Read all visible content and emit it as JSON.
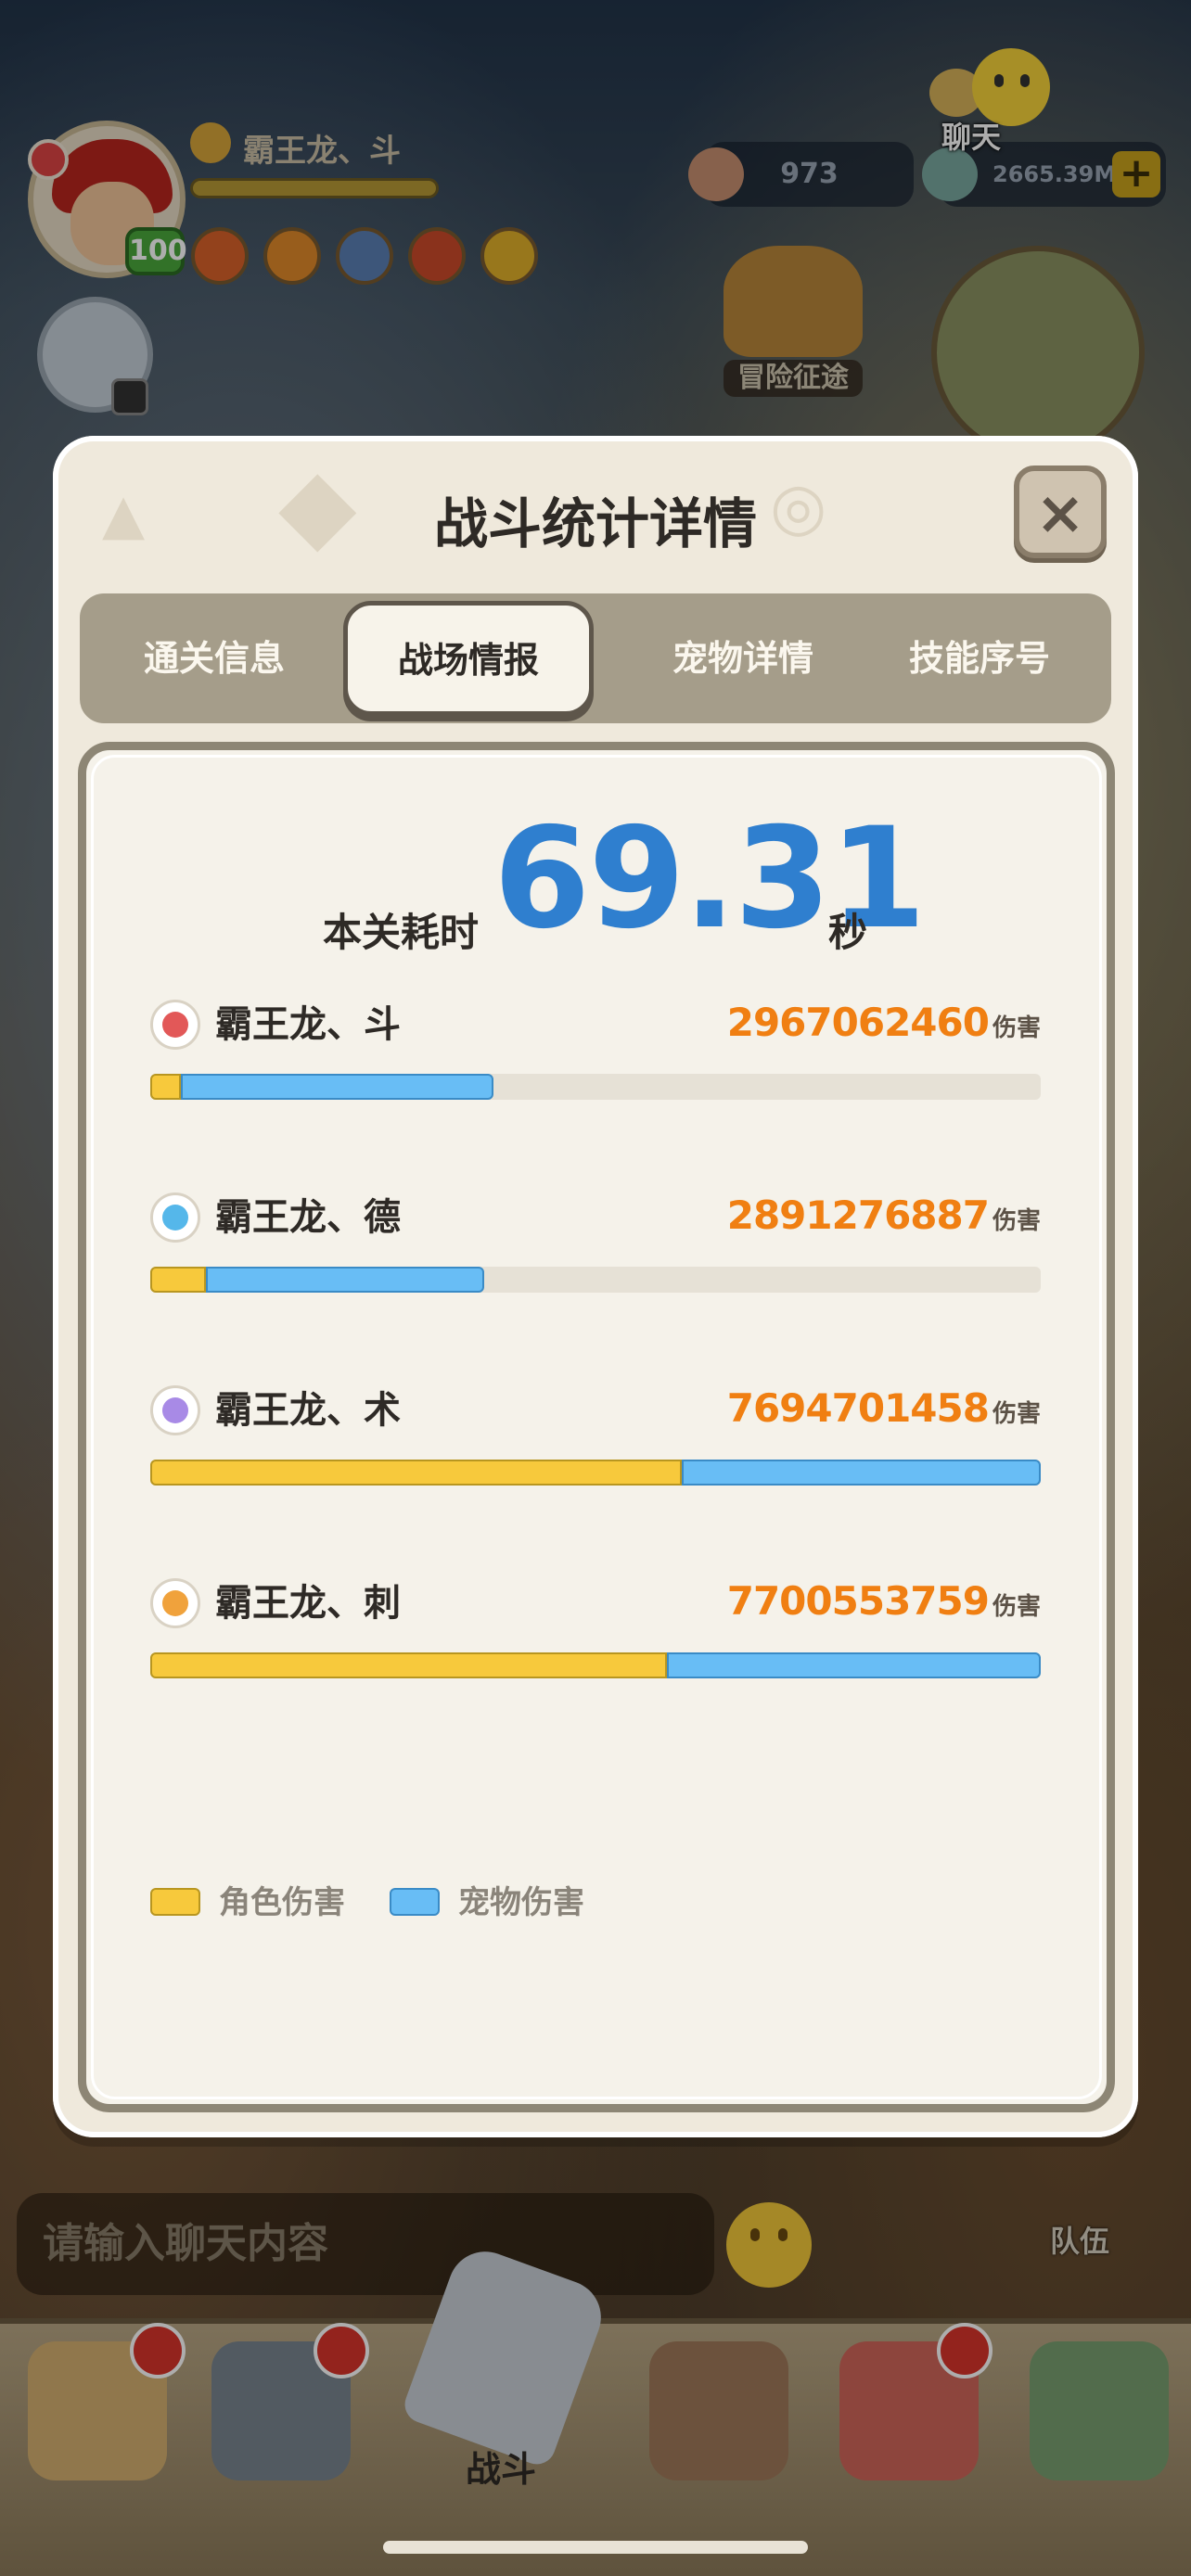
{
  "hud": {
    "player_name": "霸王龙、斗",
    "level": "100",
    "currency_1": "973",
    "currency_2": "2665.39M",
    "plus": "+",
    "chat_label": "聊天",
    "adventure_label": "冒险征途"
  },
  "modal": {
    "title": "战斗统计详情",
    "close": "×",
    "tabs": [
      {
        "label": "通关信息",
        "active": false
      },
      {
        "label": "战场情报",
        "active": true
      },
      {
        "label": "宠物详情",
        "active": false
      },
      {
        "label": "技能序号",
        "active": false
      }
    ],
    "time_label": "本关耗时",
    "time_value": "69.31",
    "time_unit": "秒",
    "damage_unit": "伤害",
    "rows": [
      {
        "name": "霸王龙、斗",
        "damage": "2967062460",
        "icon": "red-fist-icon",
        "character_fraction": 0.034,
        "pet_fraction": 0.351
      },
      {
        "name": "霸王龙、德",
        "damage": "2891276887",
        "icon": "blue-swirl-icon",
        "character_fraction": 0.063,
        "pet_fraction": 0.312
      },
      {
        "name": "霸王龙、术",
        "damage": "7694701458",
        "icon": "purple-spiral-icon",
        "character_fraction": 0.597,
        "pet_fraction": 0.403
      },
      {
        "name": "霸王龙、刺",
        "damage": "7700553759",
        "icon": "orange-blade-icon",
        "character_fraction": 0.58,
        "pet_fraction": 0.42
      }
    ],
    "legend": {
      "character": "角色伤害",
      "pet": "宠物伤害"
    }
  },
  "bottom": {
    "chat_placeholder": "请输入聊天内容",
    "team_label": "队伍",
    "battle_label": "战斗"
  },
  "colors": {
    "character_bar": "#f7c93c",
    "pet_bar": "#68bdf5",
    "time_value": "#2f7fcf",
    "damage_value": "#f07f12"
  }
}
